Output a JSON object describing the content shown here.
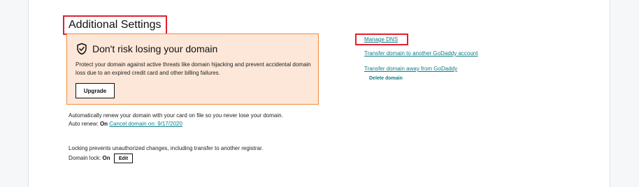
{
  "section": {
    "title": "Additional Settings"
  },
  "promo": {
    "icon": "shield-check-icon",
    "title": "Don't risk losing your domain",
    "text": "Protect your domain against active threats like domain hijacking and prevent accidental domain loss due to an expired credit card and other billing failures.",
    "button_label": "Upgrade"
  },
  "auto_renew": {
    "description": "Automatically renew your domain with your card on file so you never lose your domain.",
    "label": "Auto renew:",
    "status": "On",
    "cancel_link": "Cancel domain on: 9/17/2020"
  },
  "domain_lock": {
    "description": "Locking prevents unauthorized changes, including transfer to another registrar.",
    "label": "Domain lock:",
    "status": "On",
    "edit_label": "Edit"
  },
  "links": {
    "manage_dns": "Manage DNS",
    "transfer_to_account": "Transfer domain to another GoDaddy account",
    "transfer_away": "Transfer domain away from GoDaddy",
    "delete_domain": "Delete domain"
  },
  "colors": {
    "link": "#0d7d87",
    "highlight": "#e0202f",
    "promo_bg": "#fde7d8",
    "promo_border": "#f08a3c"
  }
}
